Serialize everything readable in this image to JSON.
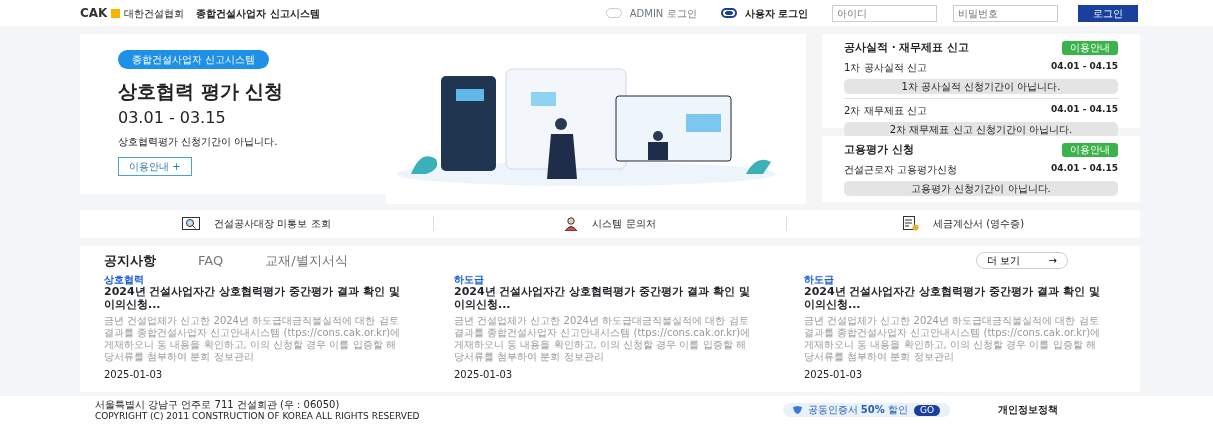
{
  "header": {
    "logo": "CAK",
    "org": "대한건설협회",
    "title": "종합건설사업자 신고시스템",
    "login_types": [
      {
        "label": "ADMIN 로그인",
        "selected": false
      },
      {
        "label": "사용자 로그인",
        "selected": true
      }
    ],
    "fields": [
      {
        "placeholder": "아이디"
      },
      {
        "placeholder": "비밀번호"
      }
    ],
    "login_button": "로그인"
  },
  "hero": {
    "badge": "종합건설사업자 신고시스템",
    "title": "상호협력 평가 신청",
    "period": "03.01 - 03.15",
    "message": "상호협력평가 신청기간이 아닙니다.",
    "button": "이용안내",
    "button_icon": "+"
  },
  "side_cards": [
    {
      "title": "공사실적 · 재무제표 신고",
      "guide": "이용안내",
      "items": [
        {
          "label": "1차 공사실적 신고",
          "period": "04.01 - 04.15",
          "status": "1차 공사실적 신청기간이 아닙니다."
        },
        {
          "label": "2차 재무제표 신고",
          "period": "04.01 - 04.15",
          "status": "2차 재무제표 신고 신청기간이 아닙니다."
        }
      ]
    },
    {
      "title": "고용평가 신청",
      "guide": "이용안내",
      "items": [
        {
          "label": "건설근로자 고용평가신청",
          "period": "04.01 - 04.15",
          "status": "고용평가 신청기간이 아닙니다."
        }
      ]
    }
  ],
  "quick_links": [
    {
      "kind": "search",
      "label": "건설공사대장 미통보 조회"
    },
    {
      "kind": "support",
      "label": "시스템 문의처"
    },
    {
      "kind": "receipt",
      "label": "세금계산서 (영수증)"
    }
  ],
  "board": {
    "tabs": [
      {
        "label": "공지사항",
        "selected": true
      },
      {
        "label": "FAQ",
        "selected": false
      },
      {
        "label": "교재/별지서식",
        "selected": false
      }
    ],
    "more": "더 보기",
    "more_icon": "→",
    "posts": [
      {
        "category": "상호협력",
        "title": "2024년 건설사업자간 상호협력평가 중간평가 결과 확인 및 이의신청...",
        "body": "금년 건설업체가 신고한 2024년 하도급대금직불실적에 대한 검토결과를 종합건설사업자 신고안내시스템 (ttps://cons.cak.or.kr)에 게재하오니 동 내용을 확인하고, 이의 신청할 경우 이를 입증할 해당서류를 첨부하여 분회 정보관리",
        "date": "2025-01-03"
      },
      {
        "category": "하도급",
        "title": "2024년 건설사업자간 상호협력평가 중간평가 결과 확인 및 이의신청...",
        "body": "금년 건설업체가 신고한 2024년 하도급대금직불실적에 대한 검토결과를 종합건설사업자 신고안내시스템 (ttps://cons.cak.or.kr)에 게재하오니 동 내용을 확인하고, 이의 신청할 경우 이를 입증할 해당서류를 첨부하여 분회 정보관리",
        "date": "2025-01-03"
      },
      {
        "category": "하도급",
        "title": "2024년 건설사업자간 상호협력평가 중간평가 결과 확인 및 이의신청...",
        "body": "금년 건설업체가 신고한 2024년 하도급대금직불실적에 대한 검토결과를 종합건설사업자 신고안내시스템 (ttps://cons.cak.or.kr)에 게재하오니 동 내용을 확인하고, 이의 신청할 경우 이를 입증할 해당서류를 첨부하여 분회 정보관리",
        "date": "2025-01-03"
      }
    ]
  },
  "footer": {
    "address": "서울특별시 강남구 언주로 711 건설회관 (우 : 06050)",
    "copyright": "COPYRIGHT (C) 2011 CONSTRUCTION OF KOREA ALL RIGHTS RESERVED",
    "promo": "공동인증서 **50%** 할인",
    "promo_button": "GO",
    "privacy": "개인정보정책"
  }
}
